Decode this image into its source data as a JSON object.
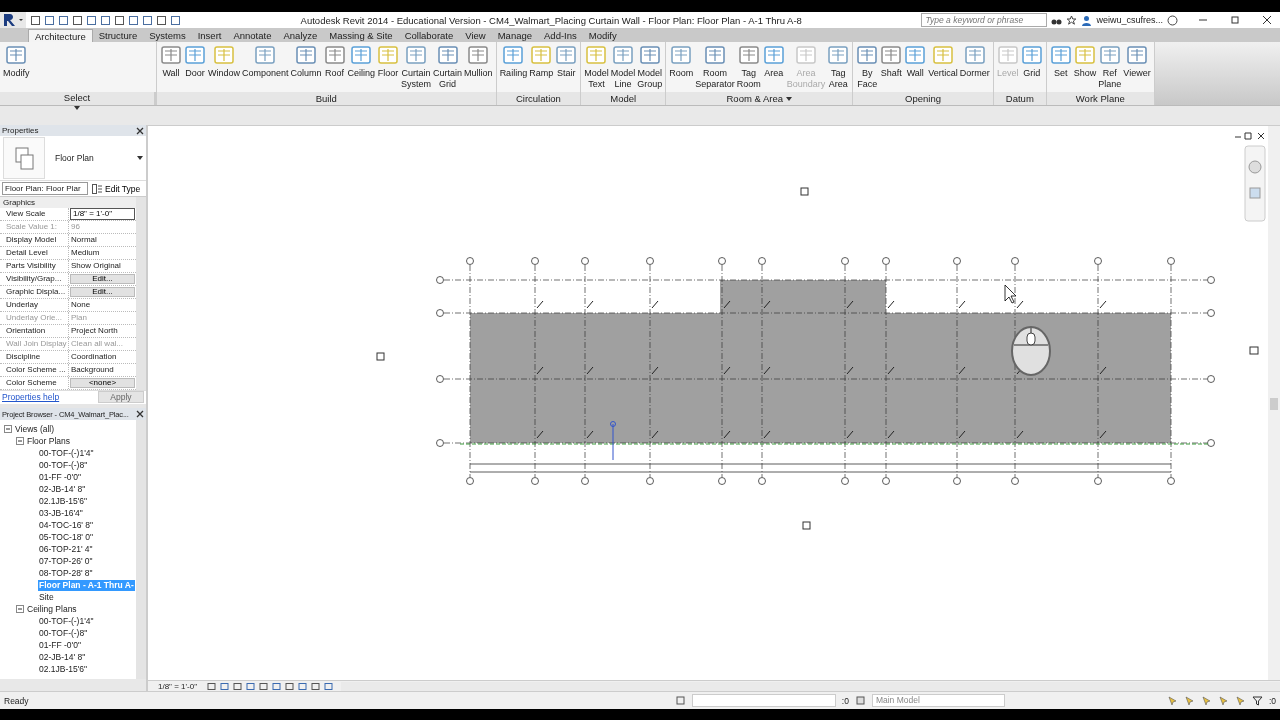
{
  "title_bar": {
    "title": "Autodesk Revit 2014 - Educational Version -    CM4_Walmart_Placing Curtain Wall - Floor Plan: Floor Plan - A-1 Thru A-8",
    "search_placeholder": "Type a keyword or phrase",
    "user": "weiwu_csufres..."
  },
  "tabs": [
    {
      "label": "Architecture",
      "selected": true
    },
    {
      "label": "Structure",
      "selected": false
    },
    {
      "label": "Systems",
      "selected": false
    },
    {
      "label": "Insert",
      "selected": false
    },
    {
      "label": "Annotate",
      "selected": false
    },
    {
      "label": "Analyze",
      "selected": false
    },
    {
      "label": "Massing & Site",
      "selected": false
    },
    {
      "label": "Collaborate",
      "selected": false
    },
    {
      "label": "View",
      "selected": false
    },
    {
      "label": "Manage",
      "selected": false
    },
    {
      "label": "Add-Ins",
      "selected": false
    },
    {
      "label": "Modify",
      "selected": false
    }
  ],
  "ribbon_panels": [
    {
      "name": "Select",
      "menu": true,
      "tools": [
        {
          "label": "Modify",
          "disabled": false
        }
      ]
    },
    {
      "name": "Build",
      "tools": [
        {
          "label": "Wall",
          "disabled": false
        },
        {
          "label": "Door",
          "disabled": false
        },
        {
          "label": "Window",
          "disabled": false
        },
        {
          "label": "Component",
          "disabled": false
        },
        {
          "label": "Column",
          "disabled": false
        },
        {
          "label": "Roof",
          "disabled": false
        },
        {
          "label": "Ceiling",
          "disabled": false
        },
        {
          "label": "Floor",
          "disabled": false
        },
        {
          "label": "Curtain System",
          "disabled": false
        },
        {
          "label": "Curtain Grid",
          "disabled": false
        },
        {
          "label": "Mullion",
          "disabled": false
        }
      ]
    },
    {
      "name": "Circulation",
      "tools": [
        {
          "label": "Railing",
          "disabled": false
        },
        {
          "label": "Ramp",
          "disabled": false
        },
        {
          "label": "Stair",
          "disabled": false
        }
      ]
    },
    {
      "name": "Model",
      "tools": [
        {
          "label": "Model Text",
          "disabled": false
        },
        {
          "label": "Model Line",
          "disabled": false
        },
        {
          "label": "Model Group",
          "disabled": false
        }
      ]
    },
    {
      "name": "Room & Area",
      "menu": true,
      "tools": [
        {
          "label": "Room",
          "disabled": false
        },
        {
          "label": "Room Separator",
          "disabled": false
        },
        {
          "label": "Tag Room",
          "disabled": false
        },
        {
          "label": "Area",
          "disabled": false
        },
        {
          "label": "Area Boundary",
          "disabled": true
        },
        {
          "label": "Tag Area",
          "disabled": false
        }
      ]
    },
    {
      "name": "Opening",
      "tools": [
        {
          "label": "By Face",
          "disabled": false
        },
        {
          "label": "Shaft",
          "disabled": false
        },
        {
          "label": "Wall",
          "disabled": false
        },
        {
          "label": "Vertical",
          "disabled": false
        },
        {
          "label": "Dormer",
          "disabled": false
        }
      ]
    },
    {
      "name": "Datum",
      "tools": [
        {
          "label": "Level",
          "disabled": true
        },
        {
          "label": "Grid",
          "disabled": false
        }
      ]
    },
    {
      "name": "Work Plane",
      "tools": [
        {
          "label": "Set",
          "disabled": false
        },
        {
          "label": "Show",
          "disabled": false
        },
        {
          "label": "Ref Plane",
          "disabled": false
        },
        {
          "label": "Viewer",
          "disabled": false
        }
      ]
    }
  ],
  "properties": {
    "title": "Properties",
    "type_name": "Floor Plan",
    "instance_selector": "Floor Plan: Floor Plar",
    "edit_type": "Edit Type",
    "section": "Graphics",
    "rows": [
      {
        "name": "View Scale",
        "value": "1/8\" = 1'-0\"",
        "kind": "field",
        "disabled": false
      },
      {
        "name": "Scale Value    1:",
        "value": "96",
        "kind": "text",
        "disabled": true
      },
      {
        "name": "Display Model",
        "value": "Normal",
        "kind": "text",
        "disabled": false
      },
      {
        "name": "Detail Level",
        "value": "Medium",
        "kind": "text",
        "disabled": false
      },
      {
        "name": "Parts Visibility",
        "value": "Show Original",
        "kind": "text",
        "disabled": false
      },
      {
        "name": "Visibility/Grap...",
        "value": "Edit...",
        "kind": "button",
        "disabled": false
      },
      {
        "name": "Graphic Displa...",
        "value": "Edit...",
        "kind": "button",
        "disabled": false
      },
      {
        "name": "Underlay",
        "value": "None",
        "kind": "text",
        "disabled": false
      },
      {
        "name": "Underlay Orie...",
        "value": "Plan",
        "kind": "text",
        "disabled": true
      },
      {
        "name": "Orientation",
        "value": "Project North",
        "kind": "text",
        "disabled": false
      },
      {
        "name": "Wall Join Display",
        "value": "Clean all wal...",
        "kind": "text",
        "disabled": true
      },
      {
        "name": "Discipline",
        "value": "Coordination",
        "kind": "text",
        "disabled": false
      },
      {
        "name": "Color Scheme ...",
        "value": "Background",
        "kind": "text",
        "disabled": false
      },
      {
        "name": "Color Scheme",
        "value": "<none>",
        "kind": "button",
        "disabled": false
      }
    ],
    "help_link": "Properties help",
    "apply": {
      "label": "Apply",
      "disabled": true
    }
  },
  "project_browser": {
    "title": "Project Browser - CM4_Walmart_Plac...",
    "tree": [
      {
        "label": "Views (all)",
        "expanded": true,
        "selected": false,
        "children": [
          {
            "label": "Floor Plans",
            "expanded": true,
            "selected": false,
            "children": [
              {
                "label": "00-TOF-(-)1'4\"",
                "selected": false
              },
              {
                "label": "00-TOF-(-)8\"",
                "selected": false
              },
              {
                "label": "01-FF -0'0\"",
                "selected": false
              },
              {
                "label": "02-JB-14' 8\"",
                "selected": false
              },
              {
                "label": "02.1JB-15'6\"",
                "selected": false
              },
              {
                "label": "03-JB-16'4\"",
                "selected": false
              },
              {
                "label": "04-TOC-16' 8\"",
                "selected": false
              },
              {
                "label": "05-TOC-18' 0\"",
                "selected": false
              },
              {
                "label": "06-TOP-21' 4\"",
                "selected": false
              },
              {
                "label": "07-TOP-26' 0\"",
                "selected": false
              },
              {
                "label": "08-TOP-28' 8\"",
                "selected": false
              },
              {
                "label": "Floor Plan - A-1 Thru A-",
                "selected": true
              },
              {
                "label": "Site",
                "selected": false
              }
            ]
          },
          {
            "label": "Ceiling Plans",
            "expanded": true,
            "selected": false,
            "children": [
              {
                "label": "00-TOF-(-)1'4\"",
                "selected": false
              },
              {
                "label": "00-TOF-(-)8\"",
                "selected": false
              },
              {
                "label": "01-FF -0'0\"",
                "selected": false
              },
              {
                "label": "02-JB-14' 8\"",
                "selected": false
              },
              {
                "label": "02.1JB-15'6\"",
                "selected": false
              }
            ]
          }
        ]
      }
    ]
  },
  "view_control_bar": {
    "scale": "1/8\" = 1'-0\""
  },
  "status_bar": {
    "message": "Ready",
    "worksets_count": ":0",
    "design_option": "Main Model",
    "filter_count": ":0"
  }
}
